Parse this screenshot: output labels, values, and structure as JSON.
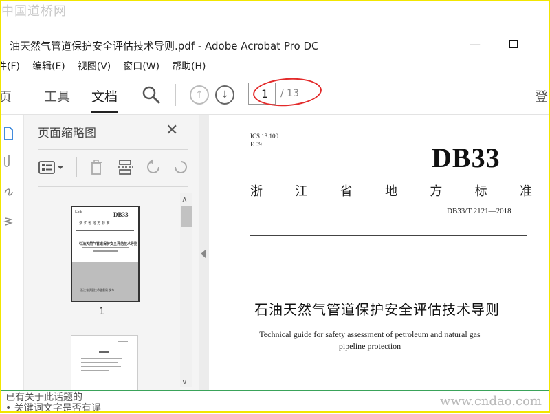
{
  "watermarks": {
    "top": "中国道桥网",
    "bottom": "www.cndao.com"
  },
  "window": {
    "title": "石油天然气管道保护安全评估技术导则.pdf - Adobe Acrobat Pro DC",
    "title_visible": "油天然气管道保护安全评估技术导则.pdf - Adobe Acrobat Pro DC"
  },
  "menu": [
    {
      "label": "件(F)"
    },
    {
      "label": "编辑(E)"
    },
    {
      "label": "视图(V)"
    },
    {
      "label": "窗口(W)"
    },
    {
      "label": "帮助(H)"
    }
  ],
  "toolbar": {
    "home": "页",
    "tools": "工具",
    "document": "文档",
    "page_current": "1",
    "page_total": "/ 13",
    "login": "登"
  },
  "thumbnails": {
    "title": "页面缩略图",
    "page_labels": [
      "1"
    ]
  },
  "document": {
    "ics": "ICS 13.100",
    "e": "E 09",
    "db": "DB33",
    "province": [
      "浙",
      "江",
      "省",
      "地",
      "方",
      "标",
      "准"
    ],
    "code": "DB33/T 2121—2018",
    "title_cn": "石油天然气管道保护安全评估技术导则",
    "title_en": "Technical guide for safety assessment of petroleum and natural gas pipeline protection"
  },
  "thumb_text": {
    "db": "DB33",
    "province": "浙 江 省 地 方 标 准",
    "title": "石油天然气管道保护安全评估技术导则",
    "bottom": "浙江省质量技术监督局  发布"
  },
  "bottom_ghost": [
    "已有关于此话题的",
    "• 关键词文字是否有误"
  ]
}
